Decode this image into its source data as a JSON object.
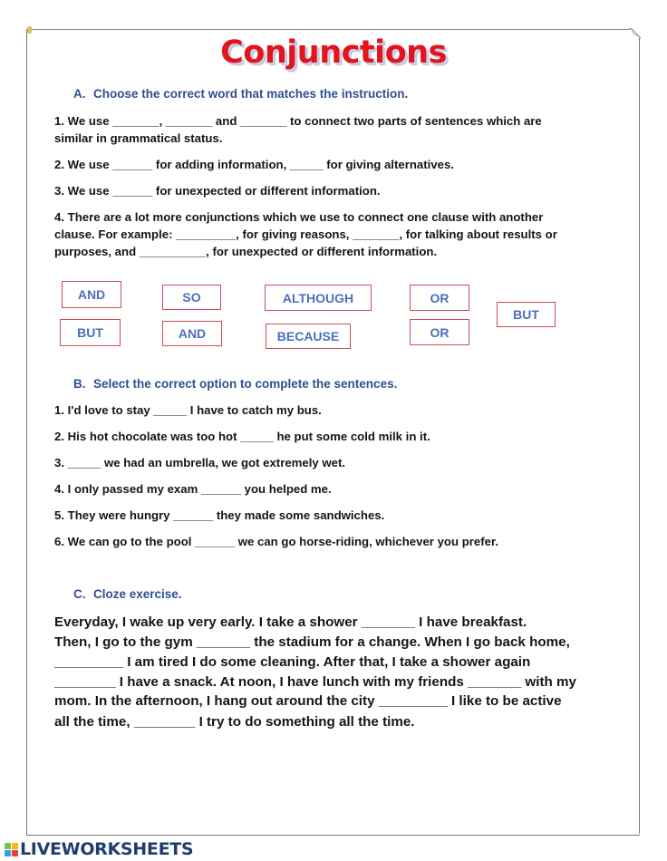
{
  "worksheet": {
    "title": "Conjunctions",
    "section_a": {
      "letter": "A.",
      "heading": "Choose the correct word that matches the instruction.",
      "lines": [
        "1. We use _______, _______ and _______ to connect two parts of sentences which are",
        "similar in grammatical status.",
        "2. We use ______ for adding information, _____ for giving alternatives.",
        "3. We use ______ for unexpected or different information.",
        "4. There are a lot more conjunctions which we use to connect one clause with another",
        "clause. For example: _________, for giving reasons, _______, for talking about results or",
        "purposes, and __________, for unexpected or different information."
      ],
      "word_bank": [
        "AND",
        "BUT",
        "SO",
        "AND",
        "ALTHOUGH",
        "BECAUSE",
        "OR",
        "OR",
        "BUT"
      ]
    },
    "section_b": {
      "letter": "B.",
      "heading": "Select the correct option to complete the sentences.",
      "lines": [
        "1. I'd love to stay _____ I have to catch my bus.",
        "2. His hot chocolate was too hot _____ he put some cold milk in it.",
        "3. _____ we had an umbrella, we got extremely wet.",
        "4. I only passed my exam ______ you helped me.",
        "5. They were hungry ______ they made some sandwiches.",
        "6. We can go to the pool ______ we can go horse-riding, whichever you prefer."
      ]
    },
    "section_c": {
      "letter": "C.",
      "heading": "Cloze exercise.",
      "lines": [
        "Everyday, I wake up very early. I take a shower _______ I have breakfast.",
        "Then, I go to the gym _______ the stadium for a change. When I go back home,",
        "_________ I am tired I do some cleaning. After that, I take a shower again",
        "________ I have a snack. At noon, I have lunch with my friends _______ with my",
        "mom. In the afternoon, I hang out around the city _________ I like to be active",
        "all the time, ________ I try to do something all the time."
      ]
    }
  },
  "footer": {
    "brand": "LIVEWORKSHEETS",
    "logo_letters": [
      "L",
      "I",
      "V",
      "E"
    ]
  },
  "colors": {
    "title": "#e3141c",
    "heading": "#2f4f8f",
    "box_border": "#d34a50",
    "box_text": "#4a6fbf",
    "brand": "#1f3d6b"
  }
}
